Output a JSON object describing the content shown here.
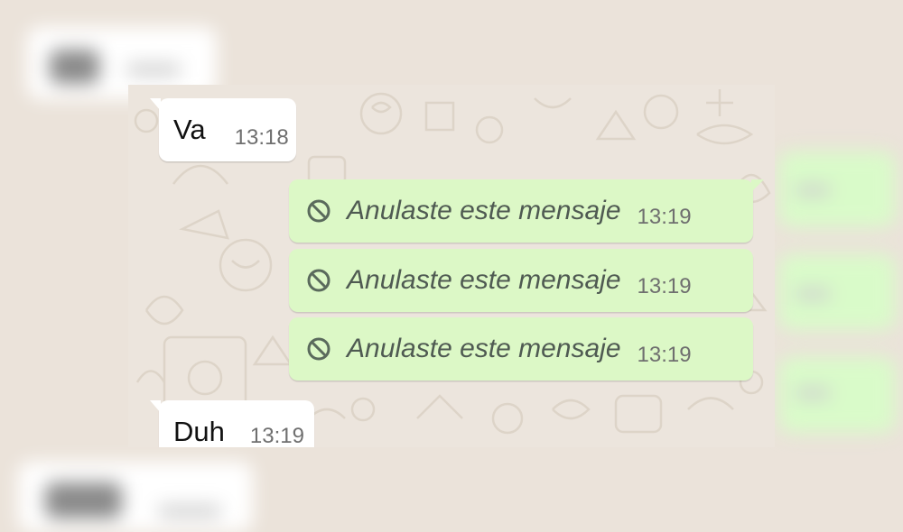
{
  "colors": {
    "incoming_bubble": "#ffffff",
    "outgoing_bubble": "#dcf8c6",
    "chat_background": "#ece5dd",
    "time_text": "#6f6f6f",
    "deleted_text": "#4f5a52"
  },
  "messages": [
    {
      "direction": "incoming",
      "text": "Va",
      "time": "13:18"
    },
    {
      "direction": "outgoing",
      "icon": "ban-icon",
      "text": "Anulaste este mensaje",
      "time": "13:19",
      "deleted": true
    },
    {
      "direction": "outgoing",
      "icon": "ban-icon",
      "text": "Anulaste este mensaje",
      "time": "13:19",
      "deleted": true
    },
    {
      "direction": "outgoing",
      "icon": "ban-icon",
      "text": "Anulaste este mensaje",
      "time": "13:19",
      "deleted": true
    },
    {
      "direction": "incoming",
      "text": "Duh",
      "time": "13:19"
    }
  ]
}
